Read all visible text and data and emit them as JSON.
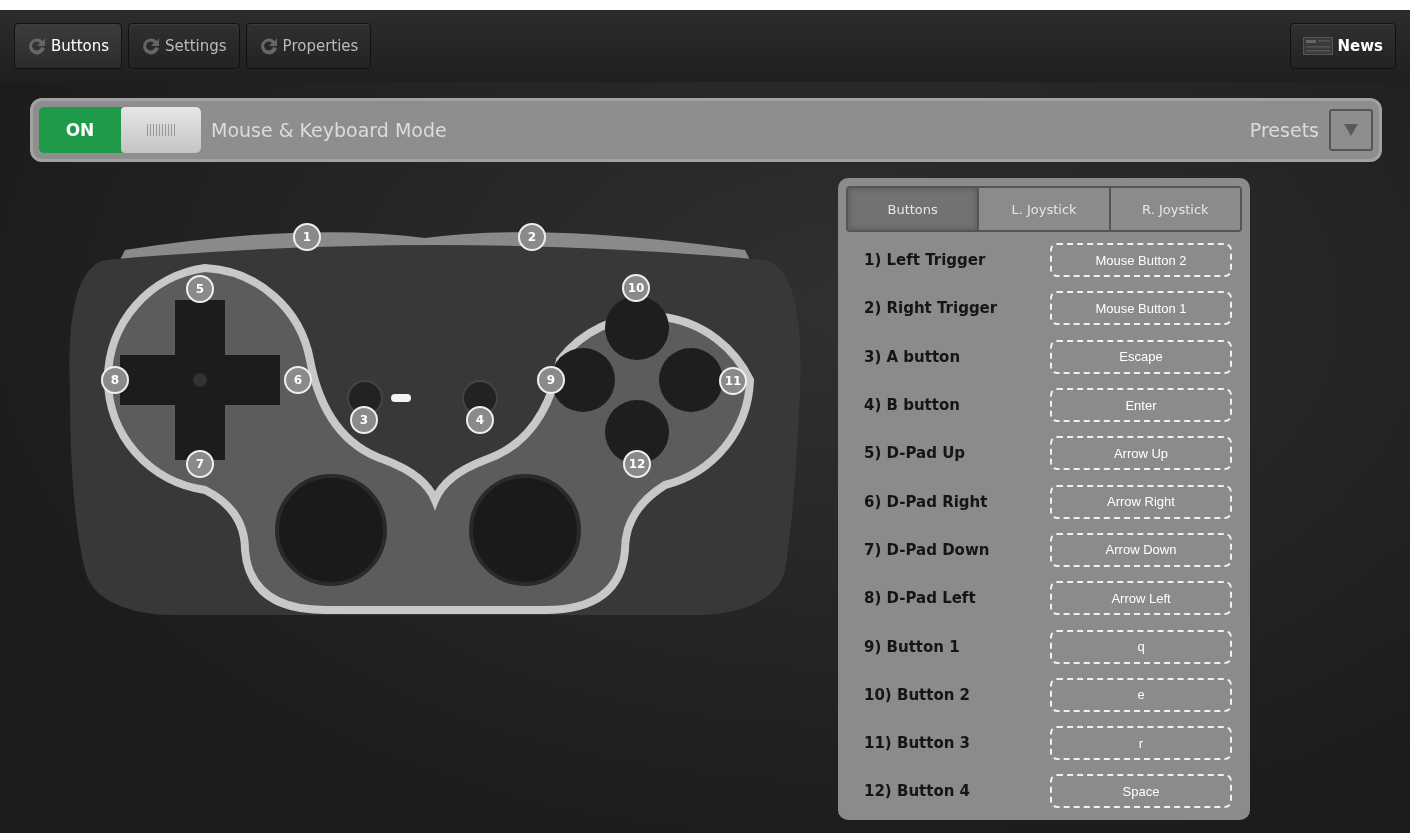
{
  "toolbar": {
    "tabs": [
      {
        "label": "Buttons",
        "selected": true
      },
      {
        "label": "Settings",
        "selected": false
      },
      {
        "label": "Properties",
        "selected": false
      }
    ],
    "news_button": "News"
  },
  "mode_bar": {
    "toggle": {
      "label": "ON",
      "on": true
    },
    "mode_label": "Mouse & Keyboard Mode",
    "presets_label": "Presets"
  },
  "controller": {
    "callouts": [
      "1",
      "2",
      "3",
      "4",
      "5",
      "6",
      "7",
      "8",
      "9",
      "10",
      "11",
      "12"
    ]
  },
  "mapping_panel": {
    "tabs": [
      {
        "label": "Buttons",
        "selected": true
      },
      {
        "label": "L. Joystick",
        "selected": false
      },
      {
        "label": "R. Joystick",
        "selected": false
      }
    ],
    "rows": [
      {
        "label": "1) Left Trigger",
        "binding": "Mouse Button 2"
      },
      {
        "label": "2) Right Trigger",
        "binding": "Mouse Button 1"
      },
      {
        "label": "3) A button",
        "binding": "Escape"
      },
      {
        "label": "4) B button",
        "binding": "Enter"
      },
      {
        "label": "5) D-Pad Up",
        "binding": "Arrow Up"
      },
      {
        "label": "6) D-Pad Right",
        "binding": "Arrow Right"
      },
      {
        "label": "7) D-Pad Down",
        "binding": "Arrow Down"
      },
      {
        "label": "8) D-Pad Left",
        "binding": "Arrow Left"
      },
      {
        "label": "9) Button 1",
        "binding": "q"
      },
      {
        "label": "10) Button 2",
        "binding": "e"
      },
      {
        "label": "11) Button 3",
        "binding": "r"
      },
      {
        "label": "12) Button 4",
        "binding": "Space"
      }
    ]
  }
}
